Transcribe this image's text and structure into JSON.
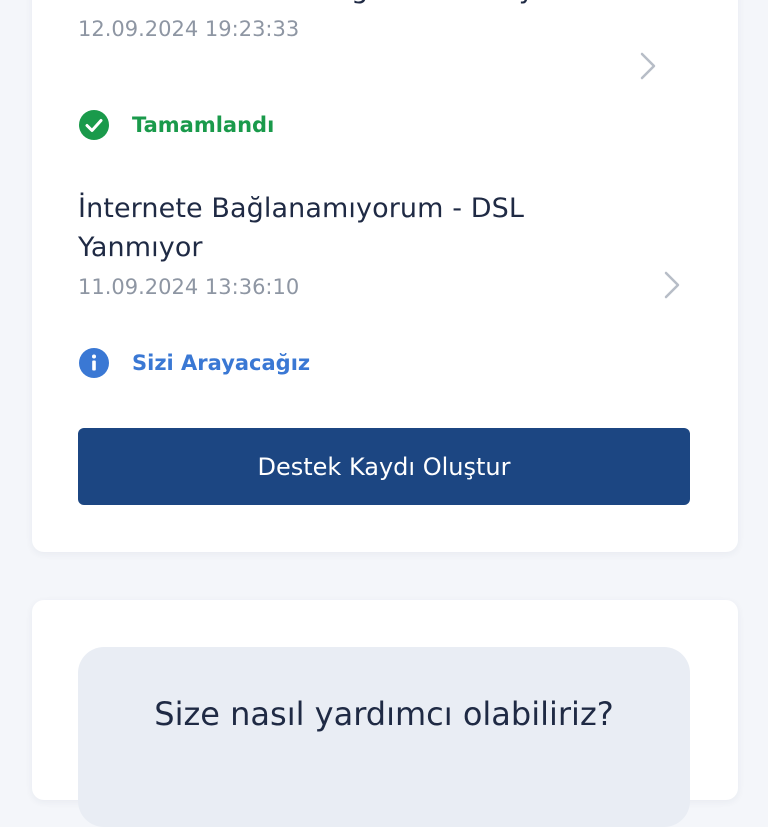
{
  "tickets": [
    {
      "title": "Arızam Hakkında Bilgi Almak İstiyorum",
      "date": "12.09.2024 19:23:33",
      "status": "Tamamlandı",
      "status_icon": "check-circle-icon",
      "status_color": "#1a9a4b"
    },
    {
      "title": "İnternete Bağlanamıyorum - DSL Yanmıyor",
      "date": "11.09.2024 13:36:10",
      "status": "Sizi Arayacağız",
      "status_icon": "info-circle-icon",
      "status_color": "#3a78d4"
    }
  ],
  "cta": {
    "label": "Destek Kaydı Oluştur",
    "color": "#1c4682"
  },
  "help": {
    "title": "Size nasıl yardımcı olabiliriz?"
  }
}
